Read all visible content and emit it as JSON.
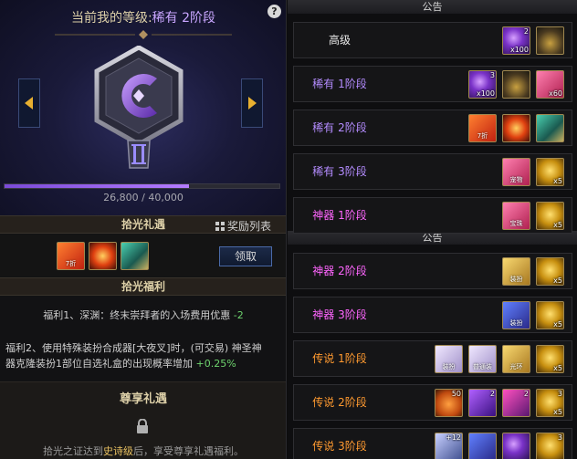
{
  "header": {
    "level_prefix": "当前我的等级:",
    "level_value": "稀有 2阶段",
    "help_icon": "?",
    "xp_text": "26,800 / 40,000",
    "xp_progress": 0.67
  },
  "gift_section": {
    "title": "拾光礼遇",
    "reward_list_label": "奖励列表",
    "claim_label": "领取",
    "items": [
      {
        "icon": "ticket-icon",
        "label": "7折"
      },
      {
        "icon": "fire-ticket-icon"
      },
      {
        "icon": "green-chest-icon"
      }
    ]
  },
  "benefit_section": {
    "title": "拾光福利",
    "benefit1": "福利1、深渊：终末崇拜者的入场费用优惠",
    "benefit1_value": "-2",
    "benefit2_line1": "福利2、使用特殊装扮合成器[大夜叉]时，(可交易) 神圣神",
    "benefit2_line2": "器克隆装扮1部位自选礼盒的出现概率增加",
    "benefit2_value": "+0.25%"
  },
  "exclusive_section": {
    "title": "尊享礼遇",
    "text_before": "拾光之证达到",
    "text_epic": "史诗级",
    "text_after": "后，享受尊享礼遇福利。"
  },
  "notices": [
    "公告",
    "公告"
  ],
  "tiers": [
    {
      "label": "高级",
      "color": "#e8e8e8",
      "items": [
        {
          "cls": "i-purple",
          "tcnt": "2",
          "cnt": "x100"
        },
        {
          "cls": "i-potion"
        }
      ]
    },
    {
      "label": "稀有 1阶段",
      "color": "#b48cff",
      "items": [
        {
          "cls": "i-purple",
          "tcnt": "3",
          "cnt": "x100"
        },
        {
          "cls": "i-potion"
        },
        {
          "cls": "i-pink",
          "cnt": "x60"
        }
      ]
    },
    {
      "label": "稀有 2阶段",
      "color": "#b48cff",
      "items": [
        {
          "cls": "i-ticket",
          "lbl": "7折"
        },
        {
          "cls": "i-fire"
        },
        {
          "cls": "i-chestg"
        }
      ]
    },
    {
      "label": "稀有 3阶段",
      "color": "#b48cff",
      "items": [
        {
          "cls": "i-pink",
          "lbl": "宠物"
        },
        {
          "cls": "i-gold",
          "cnt": "x5"
        }
      ]
    },
    {
      "label": "神器 1阶段",
      "color": "#ff66ff",
      "items": [
        {
          "cls": "i-pink",
          "lbl": "宝珠"
        },
        {
          "cls": "i-gold",
          "cnt": "x5"
        }
      ]
    },
    {
      "label": "神器 2阶段",
      "color": "#ff66ff",
      "items": [
        {
          "cls": "i-yellow",
          "lbl": "装扮"
        },
        {
          "cls": "i-gold",
          "cnt": "x5"
        }
      ]
    },
    {
      "label": "神器 3阶段",
      "color": "#ff66ff",
      "items": [
        {
          "cls": "i-blue",
          "lbl": "装扮"
        },
        {
          "cls": "i-gold",
          "cnt": "x5"
        }
      ]
    },
    {
      "label": "传说 1阶段",
      "color": "#ff9a30",
      "items": [
        {
          "cls": "i-white",
          "lbl": "装扮"
        },
        {
          "cls": "i-white",
          "lbl": "普通装"
        },
        {
          "cls": "i-yellow",
          "lbl": "光环"
        },
        {
          "cls": "i-gold",
          "cnt": "x5"
        }
      ]
    },
    {
      "label": "传说 2阶段",
      "color": "#ff9a30",
      "items": [
        {
          "cls": "i-pumpkin",
          "tcnt": "50"
        },
        {
          "cls": "i-violet",
          "tcnt": "2"
        },
        {
          "cls": "i-chestp",
          "tcnt": "2"
        },
        {
          "cls": "i-gold",
          "tcnt": "3",
          "cnt": "x5"
        }
      ]
    },
    {
      "label": "传说 3阶段",
      "color": "#ff9a30",
      "items": [
        {
          "cls": "i-map",
          "tcnt": "+12"
        },
        {
          "cls": "i-blue"
        },
        {
          "cls": "i-purple"
        },
        {
          "cls": "i-gold",
          "tcnt": "3"
        }
      ]
    }
  ]
}
